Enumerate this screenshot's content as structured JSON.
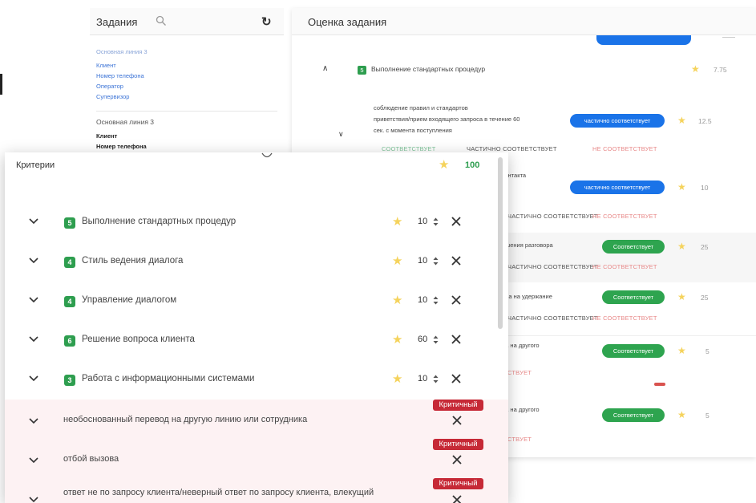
{
  "tasks_panel": {
    "title": "Задания",
    "groups": [
      {
        "title": "Основная линия 3",
        "items": [
          "Клиент",
          "Номер телефона",
          "Оператор",
          "Супервизор"
        ]
      },
      {
        "title": "Основная линия 3",
        "items": [
          "Клиент",
          "Номер телефона"
        ]
      }
    ]
  },
  "eval_panel": {
    "title": "Оценка задания",
    "section": {
      "badge": "5",
      "title": "Выполнение стандартных процедур",
      "score": "7.75"
    },
    "options": {
      "ok": "СООТВЕТСТВУЕТ",
      "partial": "ЧАСТИЧНО СООТВЕТСТВУЕТ",
      "no": "НЕ СООТВЕТСТВУЕТ"
    },
    "rows": [
      {
        "text_lines": [
          "соблюдение правил и стандартов",
          "приветствия/прием входящего запроса в течение 60",
          "сек. с момента поступления"
        ],
        "status": "частично соответствует",
        "score": "12.5"
      },
      {
        "text_lines": [
          "контакта",
          "е,"
        ],
        "status": "частично соответствует",
        "score": "10"
      },
      {
        "text_lines": [
          "ршения разговора"
        ],
        "status": "Соответствует",
        "score": "25"
      },
      {
        "text_lines": [
          "ора на удержание"
        ],
        "status": "Соответствует",
        "score": "25"
      },
      {
        "text_lines": [
          "ра на другого"
        ],
        "status": "Соответствует",
        "score": "5",
        "partial_option": "СТВУЕТ"
      },
      {
        "text_lines": [
          "ра на другого"
        ],
        "status": "Соответствует",
        "score": "5",
        "partial_option": "СТВУЕТ"
      }
    ]
  },
  "criteria": {
    "title": "Критерии",
    "total": "100",
    "categories": [
      {
        "badge": "5",
        "title": "Выполнение стандартных процедур",
        "value": "10"
      },
      {
        "badge": "4",
        "title": "Стиль ведения диалога",
        "value": "10"
      },
      {
        "badge": "4",
        "title": "Управление диалогом",
        "value": "10"
      },
      {
        "badge": "6",
        "title": "Решение вопроса клиента",
        "value": "60"
      },
      {
        "badge": "3",
        "title": "Работа с информационными системами",
        "value": "10"
      }
    ],
    "critical_items": [
      {
        "tag": "Критичный",
        "text": "необоснованный перевод на другую линию или сотрудника"
      },
      {
        "tag": "Критичный",
        "text": "отбой вызова"
      },
      {
        "tag": "Критичный",
        "text": "ответ не по запросу клиента/неверный ответ по запросу клиента, влекущий"
      }
    ]
  },
  "colors": {
    "accent_blue": "#1a73e8",
    "success_green": "#2ea44f",
    "critical_red": "#c62936",
    "star_yellow": "#f5d35c"
  },
  "icons": [
    "search-icon",
    "refresh-icon",
    "chevron-down-icon",
    "chevron-up-icon",
    "star-icon",
    "close-icon",
    "spinner-icon"
  ]
}
